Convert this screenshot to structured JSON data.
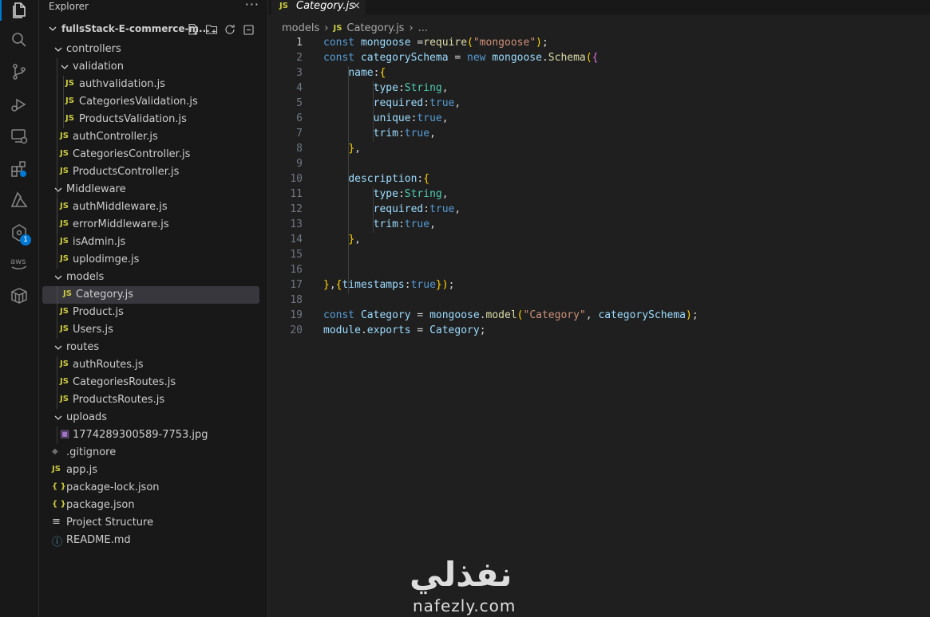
{
  "activity_bar": {
    "icons": [
      "files-icon",
      "search-icon",
      "source-control-icon",
      "run-debug-icon",
      "remote-explorer-icon",
      "extensions-icon",
      "azure-icon",
      "gitlens-icon",
      "aws-icon",
      "containers-icon"
    ],
    "badge_count": "1"
  },
  "sidebar": {
    "title": "Explorer",
    "more_label": "···",
    "project_name": "fullsStack-E-commerce-m...",
    "tree": [
      {
        "label": "controllers",
        "type": "folder",
        "depth": 1
      },
      {
        "label": "validation",
        "type": "folder",
        "depth": 2
      },
      {
        "label": "authvalidation.js",
        "type": "js",
        "depth": 3
      },
      {
        "label": "CategoriesValidation.js",
        "type": "js",
        "depth": 3
      },
      {
        "label": "ProductsValidation.js",
        "type": "js",
        "depth": 3
      },
      {
        "label": "authController.js",
        "type": "js",
        "depth": 2
      },
      {
        "label": "CategoriesController.js",
        "type": "js",
        "depth": 2
      },
      {
        "label": "ProductsController.js",
        "type": "js",
        "depth": 2
      },
      {
        "label": "Middleware",
        "type": "folder",
        "depth": 1
      },
      {
        "label": "authMiddleware.js",
        "type": "js",
        "depth": 2
      },
      {
        "label": "errorMiddleware.js",
        "type": "js",
        "depth": 2
      },
      {
        "label": "isAdmin.js",
        "type": "js",
        "depth": 2
      },
      {
        "label": "uplodimge.js",
        "type": "js",
        "depth": 2
      },
      {
        "label": "models",
        "type": "folder",
        "depth": 1
      },
      {
        "label": "Category.js",
        "type": "js",
        "depth": 2,
        "selected": true
      },
      {
        "label": "Product.js",
        "type": "js",
        "depth": 2
      },
      {
        "label": "Users.js",
        "type": "js",
        "depth": 2
      },
      {
        "label": "routes",
        "type": "folder",
        "depth": 1
      },
      {
        "label": "authRoutes.js",
        "type": "js",
        "depth": 2
      },
      {
        "label": "CategoriesRoutes.js",
        "type": "js",
        "depth": 2
      },
      {
        "label": "ProductsRoutes.js",
        "type": "js",
        "depth": 2
      },
      {
        "label": "uploads",
        "type": "folder",
        "depth": 1
      },
      {
        "label": "1774289300589-7753.jpg",
        "type": "image",
        "depth": 2
      },
      {
        "label": ".gitignore",
        "type": "git",
        "depth": 1
      },
      {
        "label": "app.js",
        "type": "js",
        "depth": 1
      },
      {
        "label": "package-lock.json",
        "type": "json",
        "depth": 1
      },
      {
        "label": "package.json",
        "type": "json",
        "depth": 1
      },
      {
        "label": "Project Structure",
        "type": "text",
        "depth": 1
      },
      {
        "label": "README.md",
        "type": "info",
        "depth": 1
      }
    ]
  },
  "editor": {
    "tab": {
      "icon_text": "JS",
      "label": "Category.js",
      "close": "×"
    },
    "breadcrumb": {
      "folder": "models",
      "icon_text": "JS",
      "file": "Category.js",
      "ellipsis": "..."
    },
    "current_line": 1,
    "lines": [
      "const mongoose =require(\"mongoose\");",
      "const categorySchema = new mongoose.Schema({",
      "    name:{",
      "        type:String,",
      "        required:true,",
      "        unique:true,",
      "        trim:true,",
      "    },",
      "",
      "    description:{",
      "        type:String,",
      "        required:true,",
      "        trim:true,",
      "    },",
      "",
      "",
      "},{timestamps:true});",
      "",
      "const Category = mongoose.model(\"Category\", categorySchema);",
      "module.exports = Category;"
    ]
  },
  "watermark": {
    "arabic": "نفذلي",
    "latin": "nafezly.com"
  },
  "colors": {
    "accent": "#0078d4",
    "js_icon": "#cbcb41",
    "selected_row": "#37373d"
  }
}
